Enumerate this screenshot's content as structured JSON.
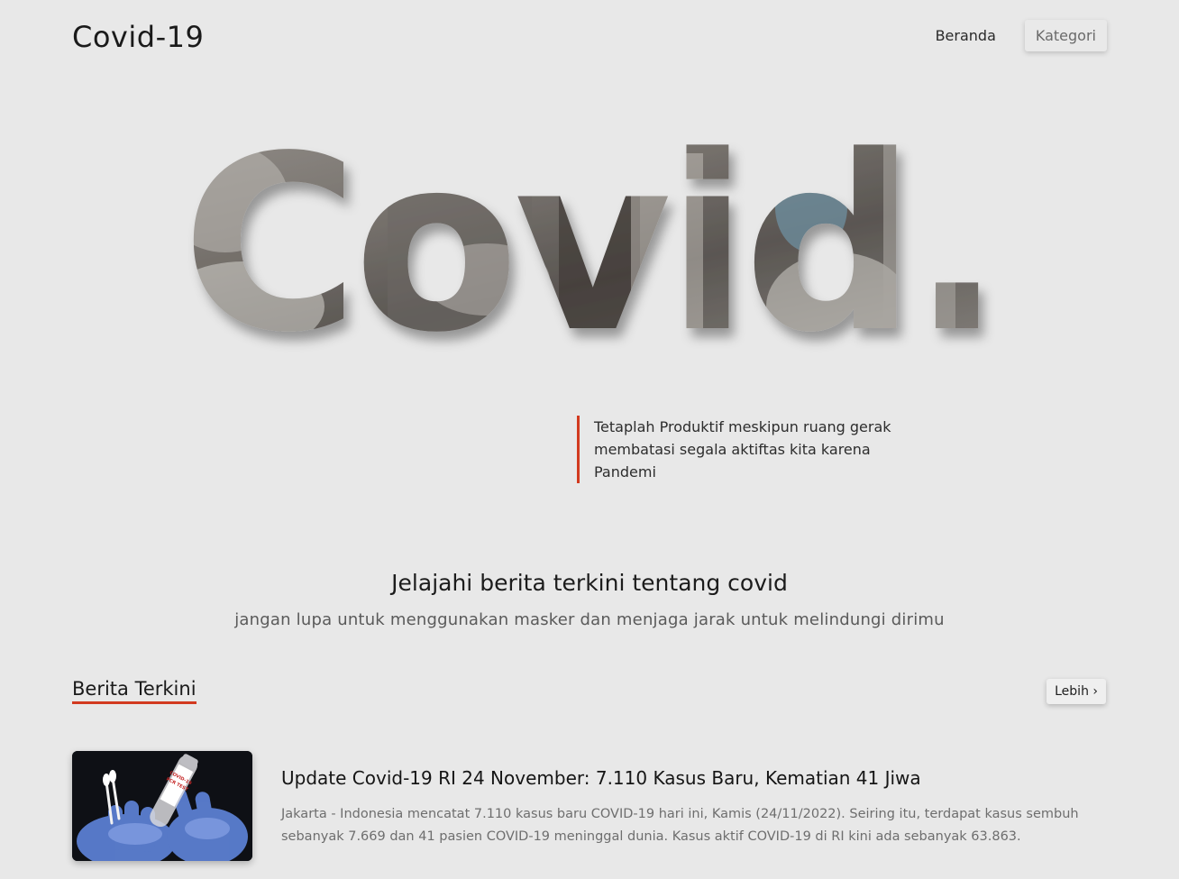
{
  "header": {
    "brand": "Covid-19",
    "nav": [
      {
        "label": "Beranda"
      },
      {
        "label": "Kategori"
      }
    ]
  },
  "hero": {
    "word": "Covid."
  },
  "quote": {
    "text": "Tetaplah Produktif meskipun ruang gerak membatasi segala aktiftas kita karena Pandemi"
  },
  "intro": {
    "title": "Jelajahi berita terkini tentang covid",
    "subtitle": "jangan lupa untuk menggunakan masker dan menjaga jarak untuk melindungi dirimu"
  },
  "news": {
    "section_title": "Berita Terkini",
    "more_label": "Lebih ›",
    "items": [
      {
        "headline": "Update Covid-19 RI 24 November: 7.110 Kasus Baru, Kematian 41 Jiwa",
        "excerpt": "Jakarta - Indonesia mencatat 7.110 kasus baru COVID-19 hari ini, Kamis (24/11/2022). Seiring itu, terdapat kasus sembuh sebanyak 7.669 dan 41 pasien COVID-19 meninggal dunia. Kasus aktif COVID-19 di RI kini ada sebanyak 63.863.",
        "image_label_line1": "COVID-19",
        "image_label_line2": "PCR TEST"
      }
    ]
  },
  "colors": {
    "background": "#e8e8e8",
    "accent": "#d23a1f"
  }
}
